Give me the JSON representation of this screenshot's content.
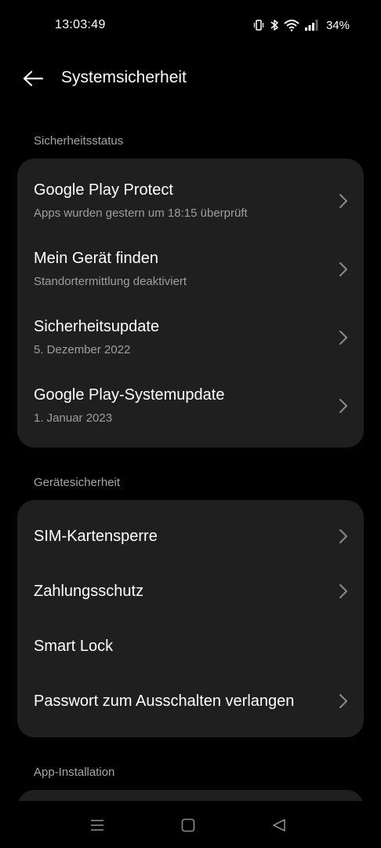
{
  "status_bar": {
    "time": "13:03:49",
    "battery": "34%",
    "icons": [
      "vibrate-icon",
      "bluetooth-icon",
      "wifi-icon",
      "signal-icon"
    ]
  },
  "header": {
    "title": "Systemsicherheit",
    "back_icon": "arrow-left-icon"
  },
  "sections": [
    {
      "header": "Sicherheitsstatus",
      "items": [
        {
          "title": "Google Play Protect",
          "subtitle": "Apps wurden gestern um 18:15 überprüft"
        },
        {
          "title": "Mein Gerät finden",
          "subtitle": "Standortermittlung deaktiviert"
        },
        {
          "title": "Sicherheitsupdate",
          "subtitle": "5. Dezember 2022"
        },
        {
          "title": "Google Play-Systemupdate",
          "subtitle": "1. Januar 2023"
        }
      ]
    },
    {
      "header": "Gerätesicherheit",
      "items": [
        {
          "title": "SIM-Kartensperre"
        },
        {
          "title": "Zahlungsschutz"
        },
        {
          "title": "Smart Lock"
        },
        {
          "title": "Passwort zum Ausschalten verlangen"
        }
      ]
    },
    {
      "header": "App-Installation",
      "items": []
    }
  ],
  "nav_bar": {
    "icons": [
      "menu-icon",
      "home-icon",
      "back-triangle-icon"
    ]
  },
  "colors": {
    "background": "#000000",
    "card": "#1f1f1f",
    "text_primary": "#ffffff",
    "text_secondary": "#9e9e9e",
    "section_header": "#a6a6a6"
  }
}
